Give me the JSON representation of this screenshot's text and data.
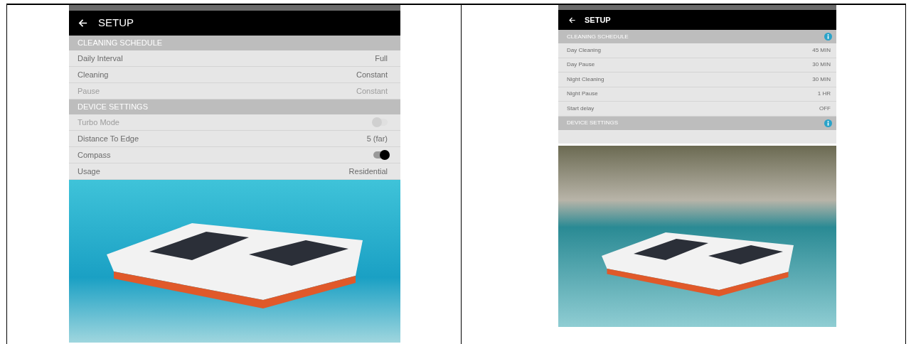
{
  "panels": [
    {
      "title": "SETUP",
      "sections": [
        {
          "title": "CLEANING SCHEDULE",
          "info": false,
          "rows": [
            {
              "kind": "value",
              "label": "Daily Interval",
              "value": "Full",
              "disabled": false
            },
            {
              "kind": "value",
              "label": "Cleaning",
              "value": "Constant",
              "disabled": false
            },
            {
              "kind": "value",
              "label": "Pause",
              "value": "Constant",
              "disabled": true
            }
          ]
        },
        {
          "title": "DEVICE SETTINGS",
          "info": false,
          "rows": [
            {
              "kind": "toggle",
              "label": "Turbo Mode",
              "on": false,
              "disabled": true
            },
            {
              "kind": "value",
              "label": "Distance To Edge",
              "value": "5 (far)",
              "disabled": false
            },
            {
              "kind": "toggle",
              "label": "Compass",
              "on": true,
              "disabled": false
            },
            {
              "kind": "value",
              "label": "Usage",
              "value": "Residential",
              "disabled": false
            }
          ]
        }
      ]
    },
    {
      "title": "SETUP",
      "sections": [
        {
          "title": "CLEANING SCHEDULE",
          "info": true,
          "rows": [
            {
              "kind": "value",
              "label": "Day Cleaning",
              "value": "45 MIN",
              "disabled": false
            },
            {
              "kind": "value",
              "label": "Day Pause",
              "value": "30 MIN",
              "disabled": false
            },
            {
              "kind": "value",
              "label": "Night Cleaning",
              "value": "30 MIN",
              "disabled": false
            },
            {
              "kind": "value",
              "label": "Night Pause",
              "value": "1 HR",
              "disabled": false
            },
            {
              "kind": "value",
              "label": "Start delay",
              "value": "OFF",
              "disabled": false
            }
          ]
        },
        {
          "title": "DEVICE SETTINGS",
          "info": true
        }
      ]
    }
  ]
}
